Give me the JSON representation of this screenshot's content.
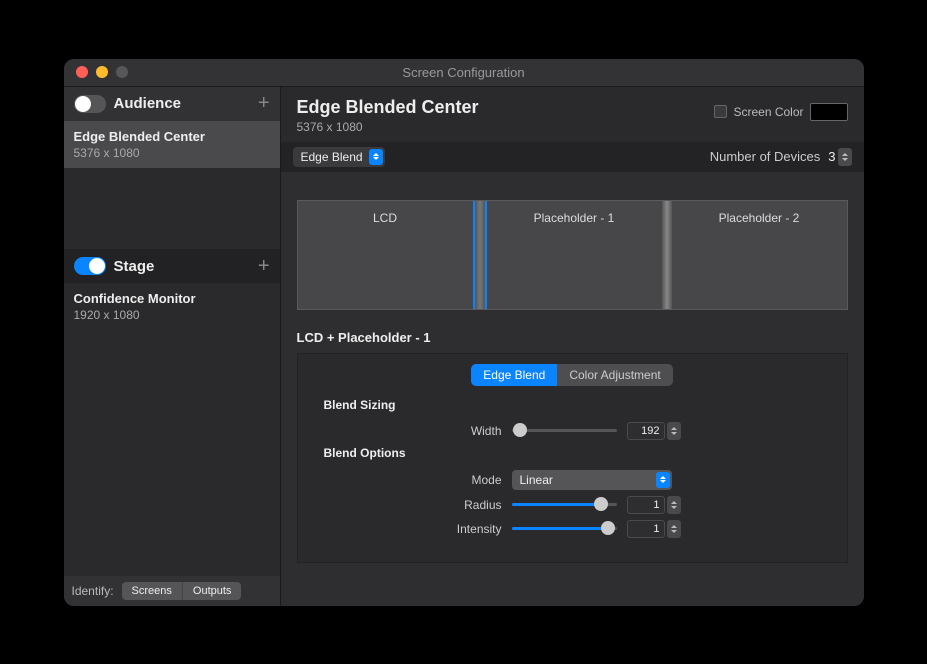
{
  "window": {
    "title": "Screen Configuration"
  },
  "sidebar": {
    "audience": {
      "label": "Audience",
      "items": [
        {
          "name": "Edge Blended Center",
          "resolution": "5376 x 1080"
        }
      ]
    },
    "stage": {
      "label": "Stage",
      "items": [
        {
          "name": "Confidence Monitor",
          "resolution": "1920 x 1080"
        }
      ]
    },
    "footer": {
      "identify_label": "Identify:",
      "screens": "Screens",
      "outputs": "Outputs"
    }
  },
  "main": {
    "title": "Edge Blended Center",
    "resolution": "5376 x 1080",
    "screen_color_label": "Screen Color",
    "mode_dropdown": "Edge Blend",
    "num_devices_label": "Number of Devices",
    "num_devices_value": "3",
    "preview": {
      "cells": [
        "LCD",
        "Placeholder - 1",
        "Placeholder - 2"
      ]
    },
    "edit": {
      "title": "LCD + Placeholder - 1",
      "tabs": {
        "edge_blend": "Edge Blend",
        "color_adjustment": "Color Adjustment"
      },
      "blend_sizing_label": "Blend Sizing",
      "width_label": "Width",
      "width_value": "192",
      "blend_options_label": "Blend Options",
      "mode_label": "Mode",
      "mode_value": "Linear",
      "radius_label": "Radius",
      "radius_value": "1",
      "intensity_label": "Intensity",
      "intensity_value": "1"
    }
  }
}
